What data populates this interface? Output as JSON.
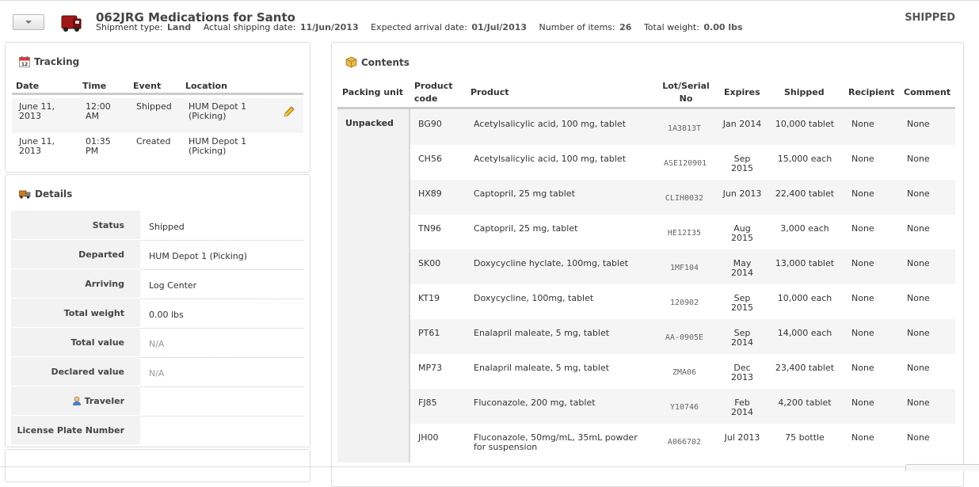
{
  "header": {
    "title": "062JRG Medications for Santo",
    "meta": [
      {
        "label": "Shipment type:",
        "value": "Land"
      },
      {
        "label": "Actual shipping date:",
        "value": "11/Jun/2013"
      },
      {
        "label": "Expected arrival date:",
        "value": "01/Jul/2013"
      },
      {
        "label": "Number of items:",
        "value": "26"
      },
      {
        "label": "Total weight:",
        "value": "0.00 lbs"
      }
    ],
    "status": "SHIPPED"
  },
  "tracking": {
    "title": "Tracking",
    "columns": {
      "date": "Date",
      "time": "Time",
      "event": "Event",
      "location": "Location"
    },
    "rows": [
      {
        "date": "June 11, 2013",
        "time": "12:00 AM",
        "event": "Shipped",
        "location": "HUM Depot 1 (Picking)",
        "editable": true
      },
      {
        "date": "June 11, 2013",
        "time": "01:35 PM",
        "event": "Created",
        "location": "HUM Depot 1 (Picking)",
        "editable": false
      }
    ]
  },
  "details": {
    "title": "Details",
    "rows": [
      {
        "label": "Status",
        "value": "Shipped"
      },
      {
        "label": "Departed",
        "value": "HUM Depot 1 (Picking)"
      },
      {
        "label": "Arriving",
        "value": "Log Center"
      },
      {
        "label": "Total weight",
        "value": "0.00 lbs"
      },
      {
        "label": "Total value",
        "value": "N/A"
      },
      {
        "label": "Declared value",
        "value": "N/A"
      },
      {
        "label": "Traveler",
        "value": ""
      },
      {
        "label": "License Plate Number",
        "value": ""
      }
    ]
  },
  "contents": {
    "title": "Contents",
    "columns": {
      "packing_unit": "Packing unit",
      "product_code": "Product code",
      "product": "Product",
      "lot": "Lot/Serial No",
      "expires": "Expires",
      "shipped": "Shipped",
      "recipient": "Recipient",
      "comment": "Comment"
    },
    "packing_unit": "Unpacked",
    "rows": [
      {
        "code": "BG90",
        "product": "Acetylsalicylic acid, 100 mg, tablet",
        "lot": "1A3813T",
        "expires": "Jan 2014",
        "shipped": "10,000 tablet",
        "recipient": "None",
        "comment": "None"
      },
      {
        "code": "CH56",
        "product": "Acetylsalicylic acid, 100 mg, tablet",
        "lot": "ASE120901",
        "expires": "Sep 2015",
        "shipped": "15,000 each",
        "recipient": "None",
        "comment": "None"
      },
      {
        "code": "HX89",
        "product": "Captopril, 25 mg tablet",
        "lot": "CLIH0032",
        "expires": "Jun 2013",
        "shipped": "22,400 tablet",
        "recipient": "None",
        "comment": "None"
      },
      {
        "code": "TN96",
        "product": "Captopril, 25 mg, tablet",
        "lot": "HE12I35",
        "expires": "Aug 2015",
        "shipped": "3,000 each",
        "recipient": "None",
        "comment": "None"
      },
      {
        "code": "SK00",
        "product": "Doxycycline hyclate, 100mg, tablet",
        "lot": "1MF104",
        "expires": "May 2014",
        "shipped": "13,000 tablet",
        "recipient": "None",
        "comment": "None"
      },
      {
        "code": "KT19",
        "product": "Doxycycline, 100mg, tablet",
        "lot": "120902",
        "expires": "Sep 2015",
        "shipped": "10,000 each",
        "recipient": "None",
        "comment": "None"
      },
      {
        "code": "PT61",
        "product": "Enalapril maleate, 5 mg, tablet",
        "lot": "AA-0905E",
        "expires": "Sep 2014",
        "shipped": "14,000 each",
        "recipient": "None",
        "comment": "None"
      },
      {
        "code": "MP73",
        "product": "Enalapril maleate, 5 mg, tablet",
        "lot": "ZMA06",
        "expires": "Dec 2013",
        "shipped": "23,400 tablet",
        "recipient": "None",
        "comment": "None"
      },
      {
        "code": "FJ85",
        "product": "Fluconazole, 200 mg, tablet",
        "lot": "Y10746",
        "expires": "Feb 2014",
        "shipped": "4,200 tablet",
        "recipient": "None",
        "comment": "None"
      },
      {
        "code": "JH00",
        "product": "Fluconazole, 50mg/mL, 35mL powder for suspension",
        "lot": "A066702",
        "expires": "Jul 2013",
        "shipped": "75 bottle",
        "recipient": "None",
        "comment": "None"
      }
    ]
  },
  "icons": {
    "actions": "caret-down-icon",
    "shipment": "truck-icon",
    "tracking": "calendar-icon",
    "details": "truck-small-icon",
    "contents": "box-icon",
    "edit": "pencil-icon",
    "traveler": "person-icon"
  }
}
